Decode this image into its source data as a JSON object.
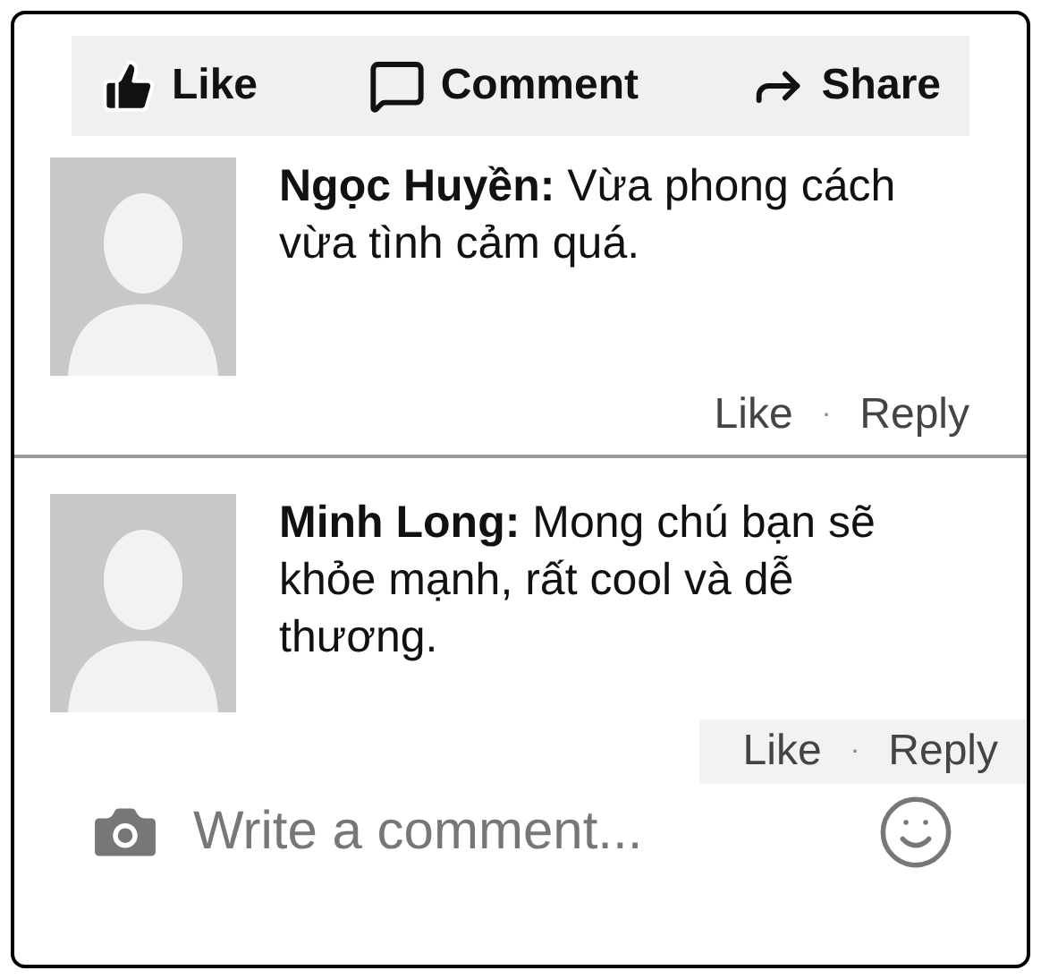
{
  "actions": [
    {
      "kind": "like",
      "label": "Like"
    },
    {
      "kind": "comment",
      "label": "Comment"
    },
    {
      "kind": "share",
      "label": "Share"
    }
  ],
  "comments": [
    {
      "text": "**Ngọc Huyền:** Vừa phong cách vừa tình cảm quá.",
      "like": "Like",
      "separator": "·",
      "reply": "Reply"
    },
    {
      "text": "**Minh Long:** Mong chú bạn sẽ khỏe mạnh, rất cool và dễ thương.",
      "like": "Like",
      "separator": "·",
      "reply": "Reply"
    }
  ],
  "composer": {
    "placeholder": "Write a comment..."
  }
}
